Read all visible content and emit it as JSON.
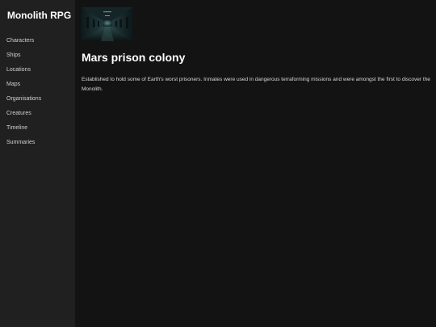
{
  "app": {
    "title": "Monolith RPG"
  },
  "sidebar": {
    "items": [
      {
        "label": "Characters"
      },
      {
        "label": "Ships"
      },
      {
        "label": "Locations"
      },
      {
        "label": "Maps"
      },
      {
        "label": "Organisations"
      },
      {
        "label": "Creatures"
      },
      {
        "label": "Timeline"
      },
      {
        "label": "Summaries"
      }
    ]
  },
  "page": {
    "image_icon": "prison-corridor-image",
    "title": "Mars prison colony",
    "description": "Established to hold some of Earth's worst prisoners. Inmates were used in dangerous terraforming missions and were amongst the first to discover the Monolith."
  },
  "colors": {
    "sidebar_bg": "#202020",
    "main_bg": "#131313",
    "text": "#ffffff"
  }
}
